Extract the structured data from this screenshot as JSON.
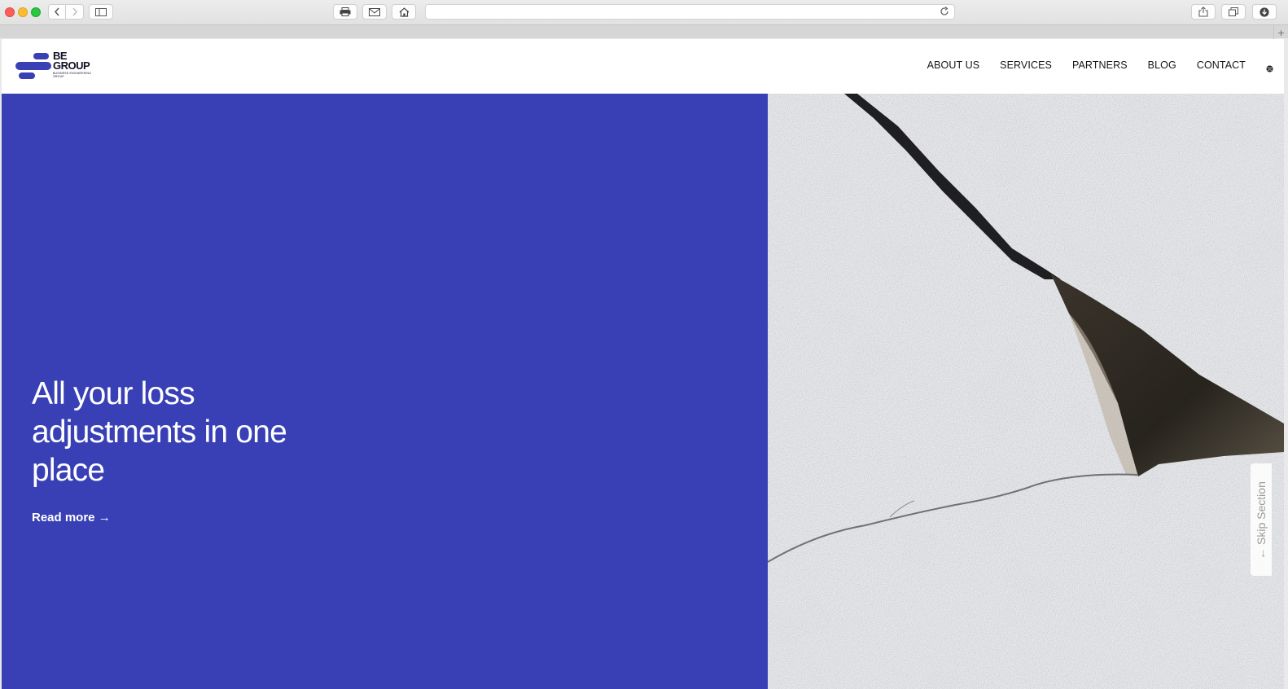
{
  "browser": {
    "icons": [
      "close-dot",
      "minimize-dot",
      "maximize-dot",
      "back-icon",
      "forward-icon",
      "sidebar-icon",
      "print-icon",
      "mail-icon",
      "home-icon",
      "reload-icon",
      "share-icon",
      "tabs-icon",
      "download-icon",
      "new-tab-icon"
    ],
    "new_tab_glyph": "+"
  },
  "header": {
    "logo": {
      "line1": "BE",
      "line2": "GROUP",
      "subtitle": "BUSINESS ENGINEERING GROUP",
      "brand_color": "#3940b5"
    },
    "nav": [
      {
        "label": "ABOUT US"
      },
      {
        "label": "SERVICES"
      },
      {
        "label": "PARTNERS"
      },
      {
        "label": "BLOG"
      },
      {
        "label": "CONTACT"
      }
    ],
    "language_icon": "globe-icon"
  },
  "hero": {
    "title": "All your loss adjustments in one place",
    "cta": "Read more →",
    "background_color": "#3940b5",
    "image_alt": "cracked-concrete-wall"
  },
  "skip_section": {
    "label": "← Skip Section"
  }
}
